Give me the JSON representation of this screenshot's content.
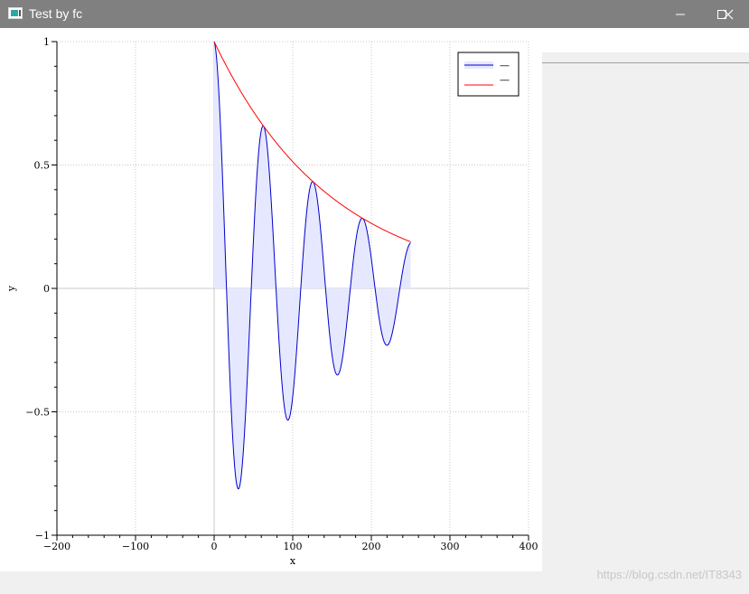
{
  "window": {
    "title": "Test by fc",
    "controls": [
      "minimize",
      "maximize",
      "close"
    ]
  },
  "watermark": "https://blog.csdn.net/IT8343",
  "chart_data": {
    "type": "line",
    "xlabel": "x",
    "ylabel": "y",
    "xlim": [
      -200,
      400
    ],
    "ylim": [
      -1,
      1
    ],
    "xticks": [
      "−200",
      "−100",
      "0",
      "100",
      "200",
      "300",
      "400"
    ],
    "yticks": [
      "1",
      "0.5",
      "0",
      "−0.5",
      "−1"
    ],
    "grid": true,
    "legend": {
      "placement": "top-right",
      "entries": [
        "—",
        "—"
      ]
    },
    "series": [
      {
        "style": "filled-line",
        "color": "#0000cc",
        "fill": "#e6e8ff",
        "formula": "exp(-x/150) * cos(2*pi*x/63)",
        "x_range": [
          0,
          250
        ],
        "points": [
          [
            0,
            1.0
          ],
          [
            31,
            -0.81
          ],
          [
            62,
            0.66
          ],
          [
            94,
            -0.53
          ],
          [
            126,
            0.43
          ],
          [
            157,
            -0.35
          ],
          [
            188,
            0.28
          ],
          [
            220,
            -0.23
          ],
          [
            250,
            0.19
          ]
        ]
      },
      {
        "style": "line",
        "color": "#ff0000",
        "formula": "exp(-x/150)",
        "x_range": [
          0,
          250
        ],
        "points": [
          [
            0,
            1.0
          ],
          [
            62,
            0.66
          ],
          [
            126,
            0.43
          ],
          [
            188,
            0.28
          ],
          [
            250,
            0.19
          ]
        ]
      }
    ]
  }
}
